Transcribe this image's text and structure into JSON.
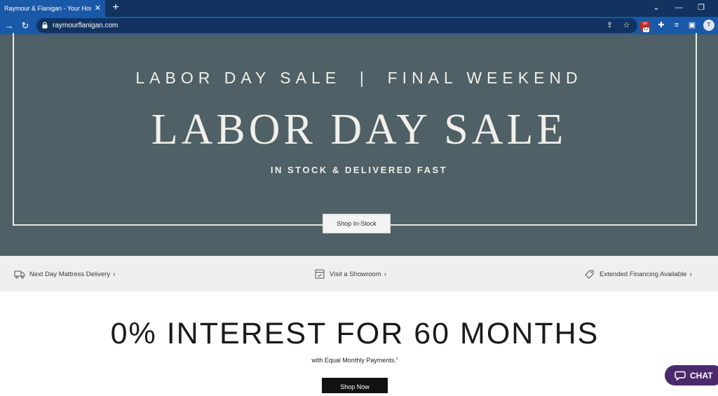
{
  "browser": {
    "tab_title": "Raymour & Flanigan - Your Home",
    "tab_close": "✕",
    "new_tab": "+",
    "url": "raymourflanigan.com",
    "extension_count": "12",
    "extension_label": "un",
    "profile_initial": "T",
    "icons": [
      "back-icon",
      "reload-icon",
      "lock-icon",
      "share-icon",
      "star-icon",
      "extension-icon",
      "puzzle-icon",
      "media-icon",
      "side-panel-icon",
      "menu-icon"
    ],
    "window_controls": [
      "chevron-down-icon",
      "minimize-icon",
      "restore-icon"
    ]
  },
  "hero": {
    "kicker": "LABOR DAY SALE  |  FINAL WEEKEND",
    "title": "LABOR DAY SALE",
    "subtitle": "IN STOCK & DELIVERED FAST",
    "button": "Shop In-Stock",
    "background_color": "#4f6066"
  },
  "services": [
    {
      "label": "Next Day Mattress Delivery",
      "icon": "truck-icon"
    },
    {
      "label": "Visit a Showroom",
      "icon": "store-icon"
    },
    {
      "label": "Extended Financing Available",
      "icon": "tag-icon"
    }
  ],
  "financing": {
    "title": "0% INTEREST FOR 60 MONTHS",
    "subtitle": "with Equal Monthly Payments.",
    "footnote_mark": "‡",
    "button": "Shop Now"
  },
  "chat": {
    "label": "CHAT",
    "color": "#4b2a6b"
  }
}
